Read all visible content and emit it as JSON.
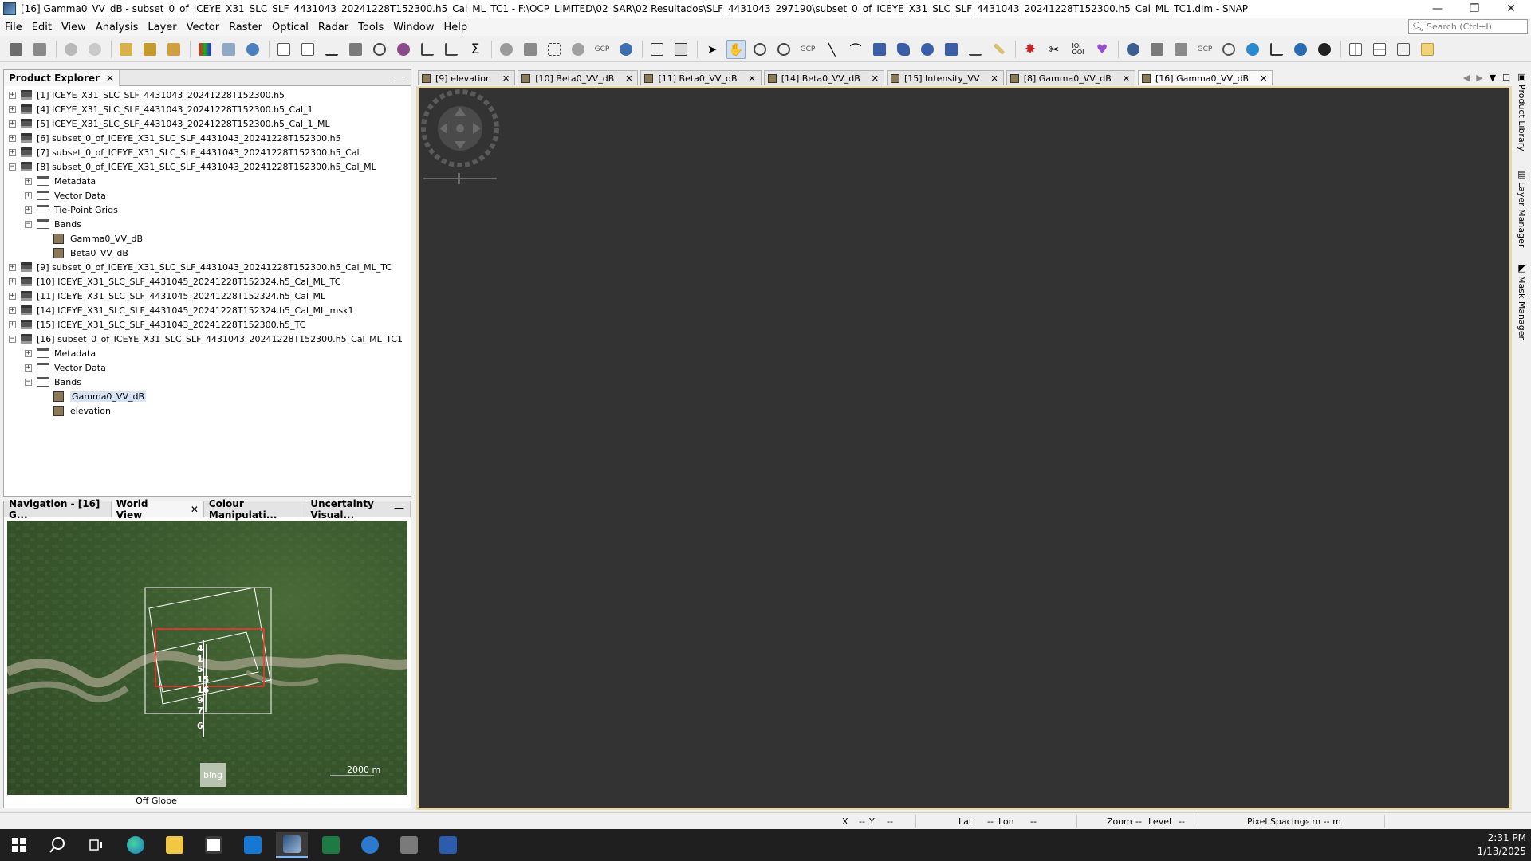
{
  "window": {
    "title": "[16] Gamma0_VV_dB - subset_0_of_ICEYE_X31_SLC_SLF_4431043_20241228T152300.h5_Cal_ML_TC1 - F:\\OCP_LIMITED\\02_SAR\\02 Resultados\\SLF_4431043_297190\\subset_0_of_ICEYE_X31_SLC_SLF_4431043_20241228T152300.h5_Cal_ML_TC1.dim - SNAP",
    "minimize": "—",
    "restore": "❐",
    "close": "✕"
  },
  "menu": [
    "File",
    "Edit",
    "View",
    "Analysis",
    "Layer",
    "Vector",
    "Raster",
    "Optical",
    "Radar",
    "Tools",
    "Window",
    "Help"
  ],
  "search": {
    "placeholder": "Search (Ctrl+I)"
  },
  "explorer": {
    "tab": "Product Explorer",
    "close": "✕",
    "minimize": "—",
    "products": [
      "[1] ICEYE_X31_SLC_SLF_4431043_20241228T152300.h5",
      "[4] ICEYE_X31_SLC_SLF_4431043_20241228T152300.h5_Cal_1",
      "[5] ICEYE_X31_SLC_SLF_4431043_20241228T152300.h5_Cal_1_ML",
      "[6] subset_0_of_ICEYE_X31_SLC_SLF_4431043_20241228T152300.h5",
      "[7] subset_0_of_ICEYE_X31_SLC_SLF_4431043_20241228T152300.h5_Cal",
      "[8] subset_0_of_ICEYE_X31_SLC_SLF_4431043_20241228T152300.h5_Cal_ML",
      "[9] subset_0_of_ICEYE_X31_SLC_SLF_4431043_20241228T152300.h5_Cal_ML_TC",
      "[10] ICEYE_X31_SLC_SLF_4431045_20241228T152324.h5_Cal_ML_TC",
      "[11] ICEYE_X31_SLC_SLF_4431045_20241228T152324.h5_Cal_ML",
      "[14] ICEYE_X31_SLC_SLF_4431045_20241228T152324.h5_Cal_ML_msk1",
      "[15] ICEYE_X31_SLC_SLF_4431043_20241228T152300.h5_TC",
      "[16] subset_0_of_ICEYE_X31_SLC_SLF_4431043_20241228T152300.h5_Cal_ML_TC1"
    ],
    "folders": {
      "metadata": "Metadata",
      "vector": "Vector Data",
      "tiepoint": "Tie-Point Grids",
      "bands": "Bands"
    },
    "p8_bands": [
      "Gamma0_VV_dB",
      "Beta0_VV_dB"
    ],
    "p16_bands": [
      "Gamma0_VV_dB",
      "elevation"
    ]
  },
  "bottom_panel": {
    "tabs": [
      "Navigation - [16] G...",
      "World View",
      "Colour Manipulati...",
      "Uncertainty Visual..."
    ],
    "close": "✕",
    "minimize": "—",
    "footprint_labels": [
      "4",
      "1",
      "5",
      "15",
      "16",
      "9",
      "7",
      "6"
    ],
    "scale": "2000 m",
    "bing": "bing",
    "status": "Off Globe"
  },
  "image_tabs": [
    "[9] elevation",
    "[10] Beta0_VV_dB",
    "[11] Beta0_VV_dB",
    "[14] Beta0_VV_dB",
    "[15] Intensity_VV",
    "[8] Gamma0_VV_dB",
    "[16] Gamma0_VV_dB"
  ],
  "image_tab_close": "✕",
  "side_tools": [
    "Product Library",
    "Layer Manager",
    "Mask Manager"
  ],
  "statusbar": {
    "x": "X",
    "x_val": "--",
    "y": "Y",
    "y_val": "--",
    "lat": "Lat",
    "lat_val": "--",
    "lon": "Lon",
    "lon_val": "--",
    "zoom": "Zoom",
    "zoom_val": "--",
    "level": "Level",
    "level_val": "--",
    "pixel_spacing": "Pixel Spacing:",
    "pixel_val": "-- m -- m"
  },
  "clock": {
    "time": "2:31 PM",
    "date": "1/13/2025"
  },
  "colors": {
    "image_bg": "#333333",
    "view_border": "#e8d8a8",
    "taskbar": "#1f1f1f"
  }
}
